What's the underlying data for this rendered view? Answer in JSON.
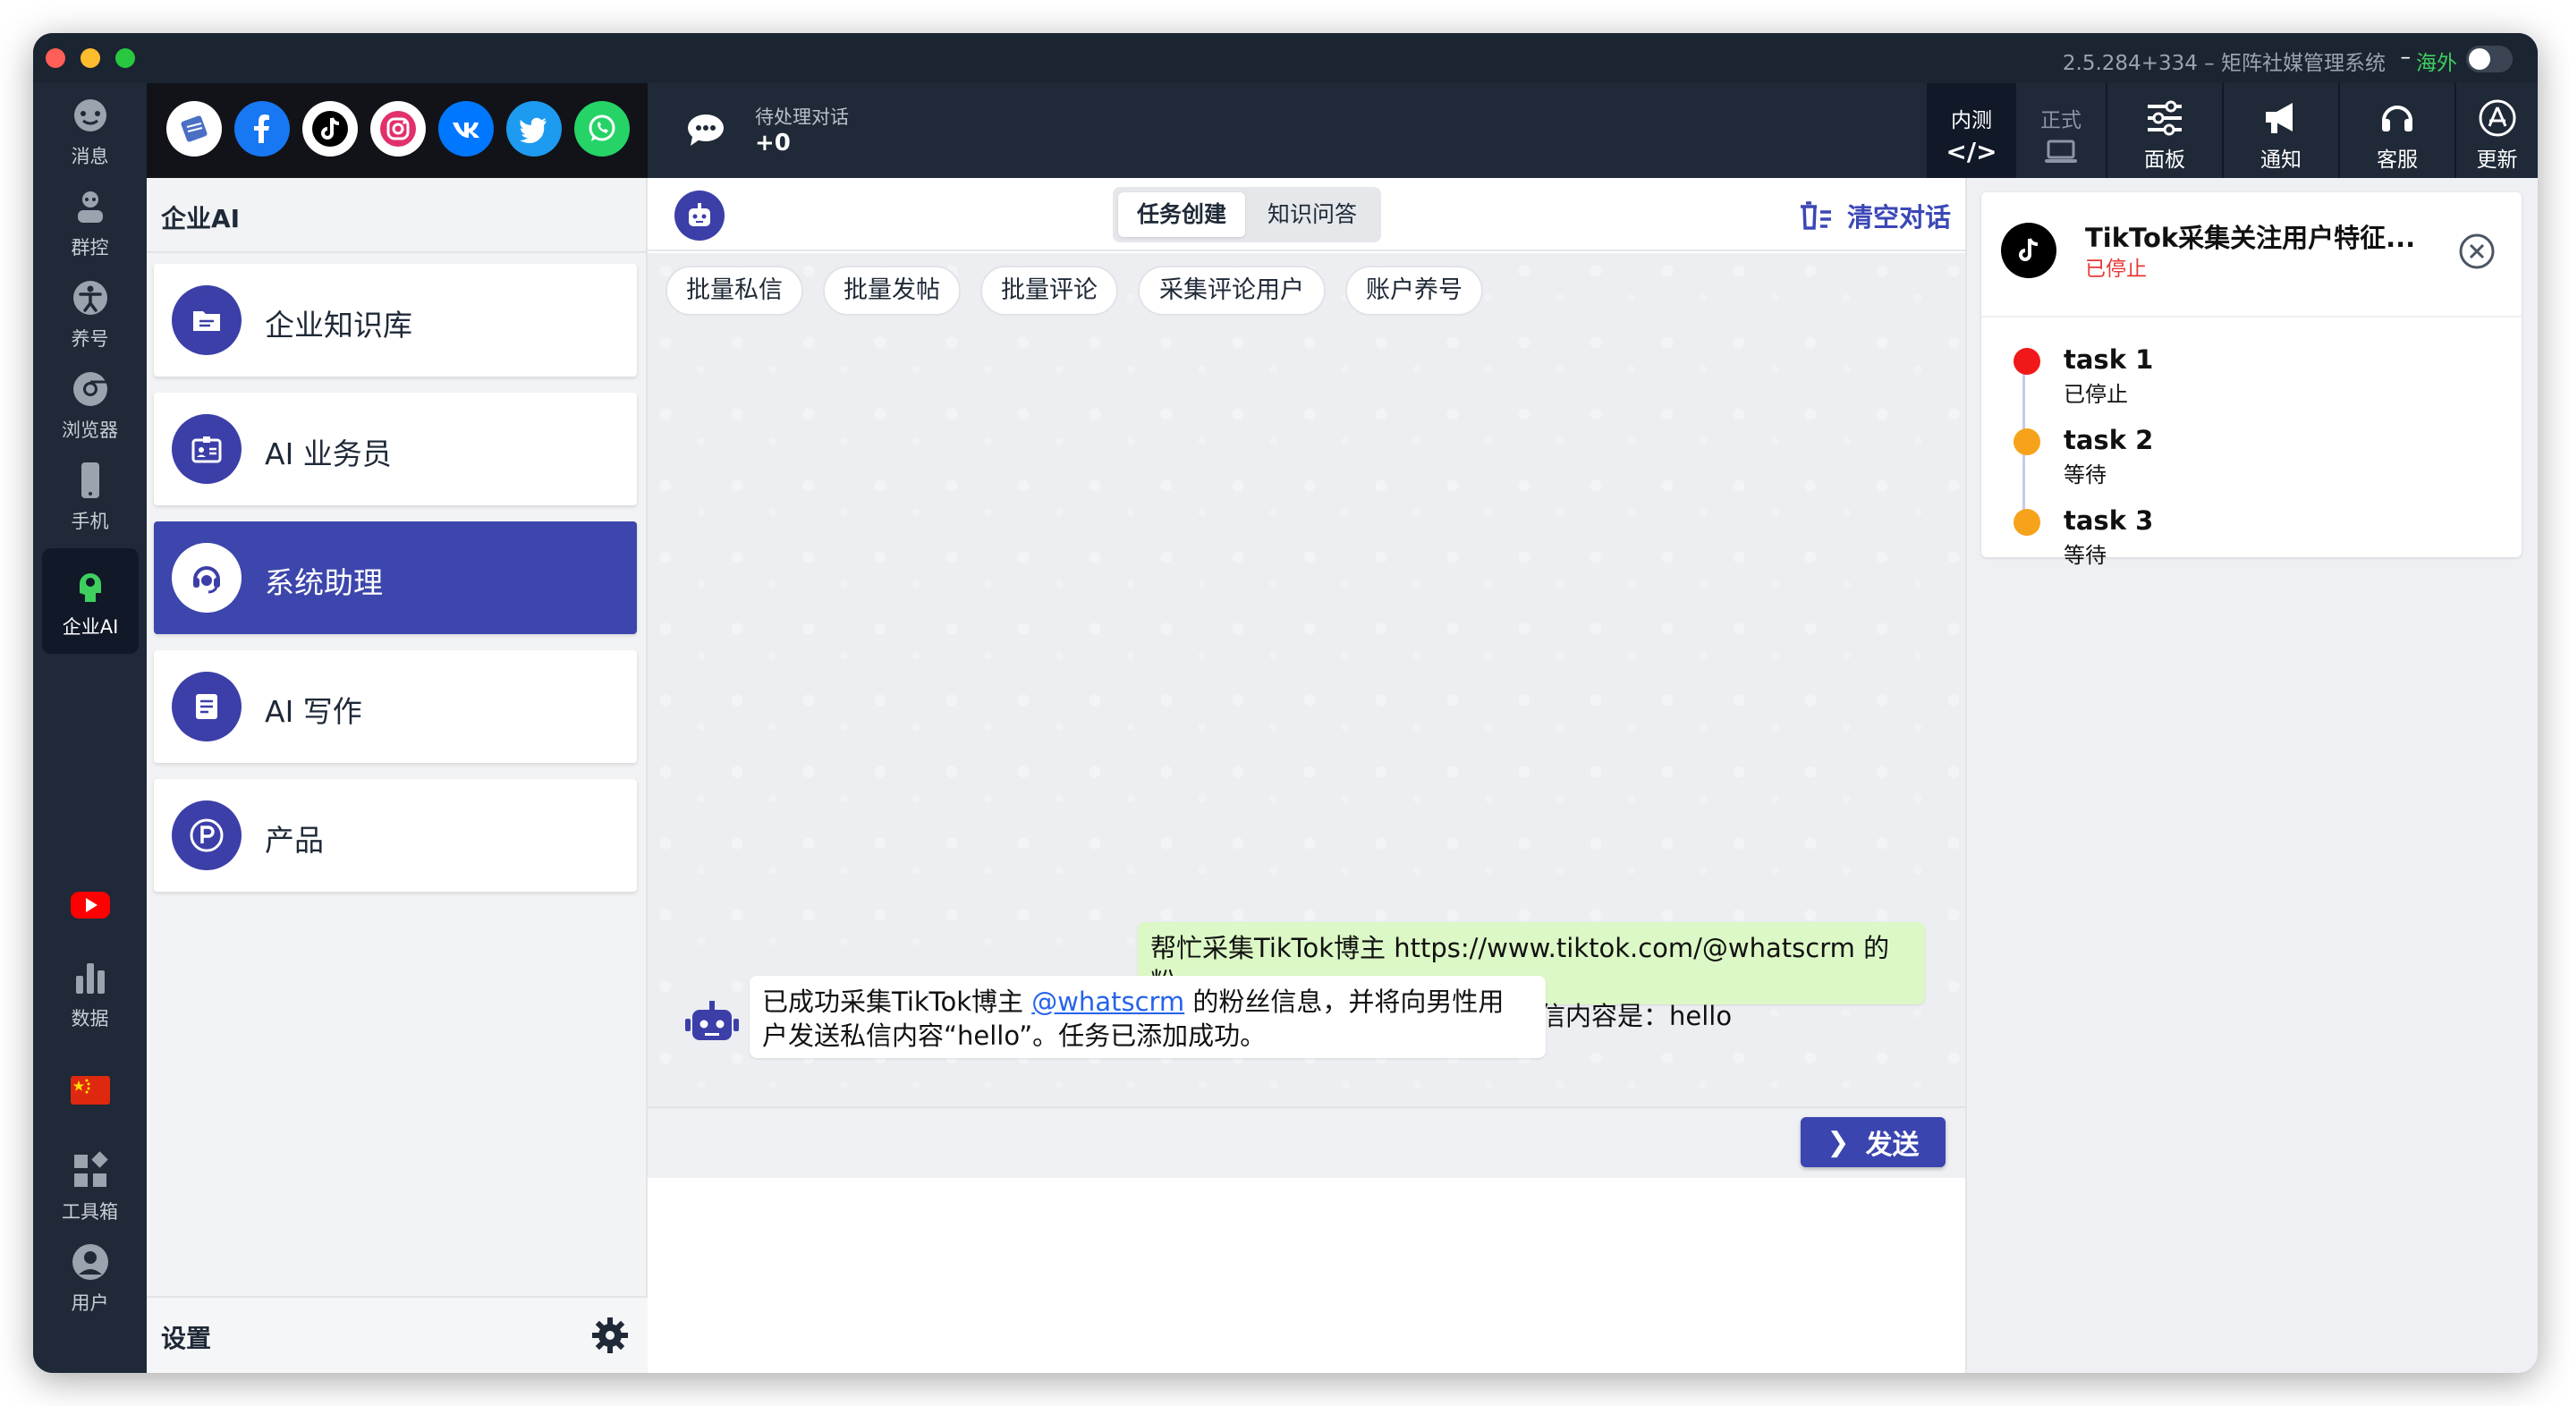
{
  "window": {
    "title": "2.5.284+334 – 矩阵社媒管理系统",
    "dash": "–",
    "region": "海外"
  },
  "rail": {
    "items": [
      {
        "label": "消息",
        "icon": "message-circle-icon"
      },
      {
        "label": "群控",
        "icon": "group-control-icon"
      },
      {
        "label": "养号",
        "icon": "accessibility-icon"
      },
      {
        "label": "浏览器",
        "icon": "chrome-icon"
      },
      {
        "label": "手机",
        "icon": "phone-icon"
      },
      {
        "label": "企业AI",
        "icon": "ai-head-icon"
      }
    ],
    "bottom_items": [
      {
        "label": "",
        "icon": "youtube-icon"
      },
      {
        "label": "数据",
        "icon": "bar-chart-icon"
      },
      {
        "label": "",
        "icon": "china-flag-icon"
      },
      {
        "label": "工具箱",
        "icon": "toolbox-icon"
      },
      {
        "label": "用户",
        "icon": "user-icon"
      }
    ]
  },
  "header": {
    "socials": [
      "wpforms-icon",
      "facebook-icon",
      "tiktok-icon",
      "instagram-icon",
      "vk-icon",
      "twitter-icon",
      "whatsapp-icon"
    ],
    "pending_label": "待处理对话",
    "pending_count": "+0",
    "env_on": "内测",
    "env_on_symbol": "</>",
    "env_off": "正式",
    "buttons": [
      {
        "label": "面板",
        "icon": "sliders-icon"
      },
      {
        "label": "通知",
        "icon": "megaphone-icon"
      },
      {
        "label": "客服",
        "icon": "headset-icon"
      },
      {
        "label": "更新",
        "icon": "app-store-icon"
      }
    ]
  },
  "categories": {
    "title": "企业AI",
    "items": [
      {
        "name": "企业知识库",
        "icon": "folder-icon"
      },
      {
        "name": "AI 业务员",
        "icon": "id-badge-icon"
      },
      {
        "name": "系统助理",
        "icon": "support-agent-icon"
      },
      {
        "name": "AI 写作",
        "icon": "document-icon"
      },
      {
        "name": "产品",
        "icon": "p-circle-icon"
      }
    ],
    "settings_label": "设置"
  },
  "chat": {
    "tabs": [
      "任务创建",
      "知识问答"
    ],
    "clear_label": "清空对话",
    "chips": [
      "批量私信",
      "批量发帖",
      "批量评论",
      "采集评论用户",
      "账户养号"
    ],
    "user_message_line1": "帮忙采集TikTok博主 https://www.tiktok.com/@whatscrm 的粉",
    "user_message_line2": "丝，选择其中男性用户并私信，私信内容是：hello",
    "bot_message_pre": "已成功采集TikTok博主 ",
    "bot_message_link": "@whatscrm",
    "bot_message_post": " 的粉丝信息，并将向男性用",
    "bot_message_line2": "户发送私信内容“hello”。任务已添加成功。",
    "send_label": "发送"
  },
  "task": {
    "title": "TikTok采集关注用户特征...",
    "status": "已停止",
    "steps": [
      {
        "name": "task 1",
        "status": "已停止",
        "color": "#f01818"
      },
      {
        "name": "task 2",
        "status": "等待",
        "color": "#f7a21b"
      },
      {
        "name": "task 3",
        "status": "等待",
        "color": "#f7a21b"
      }
    ]
  }
}
